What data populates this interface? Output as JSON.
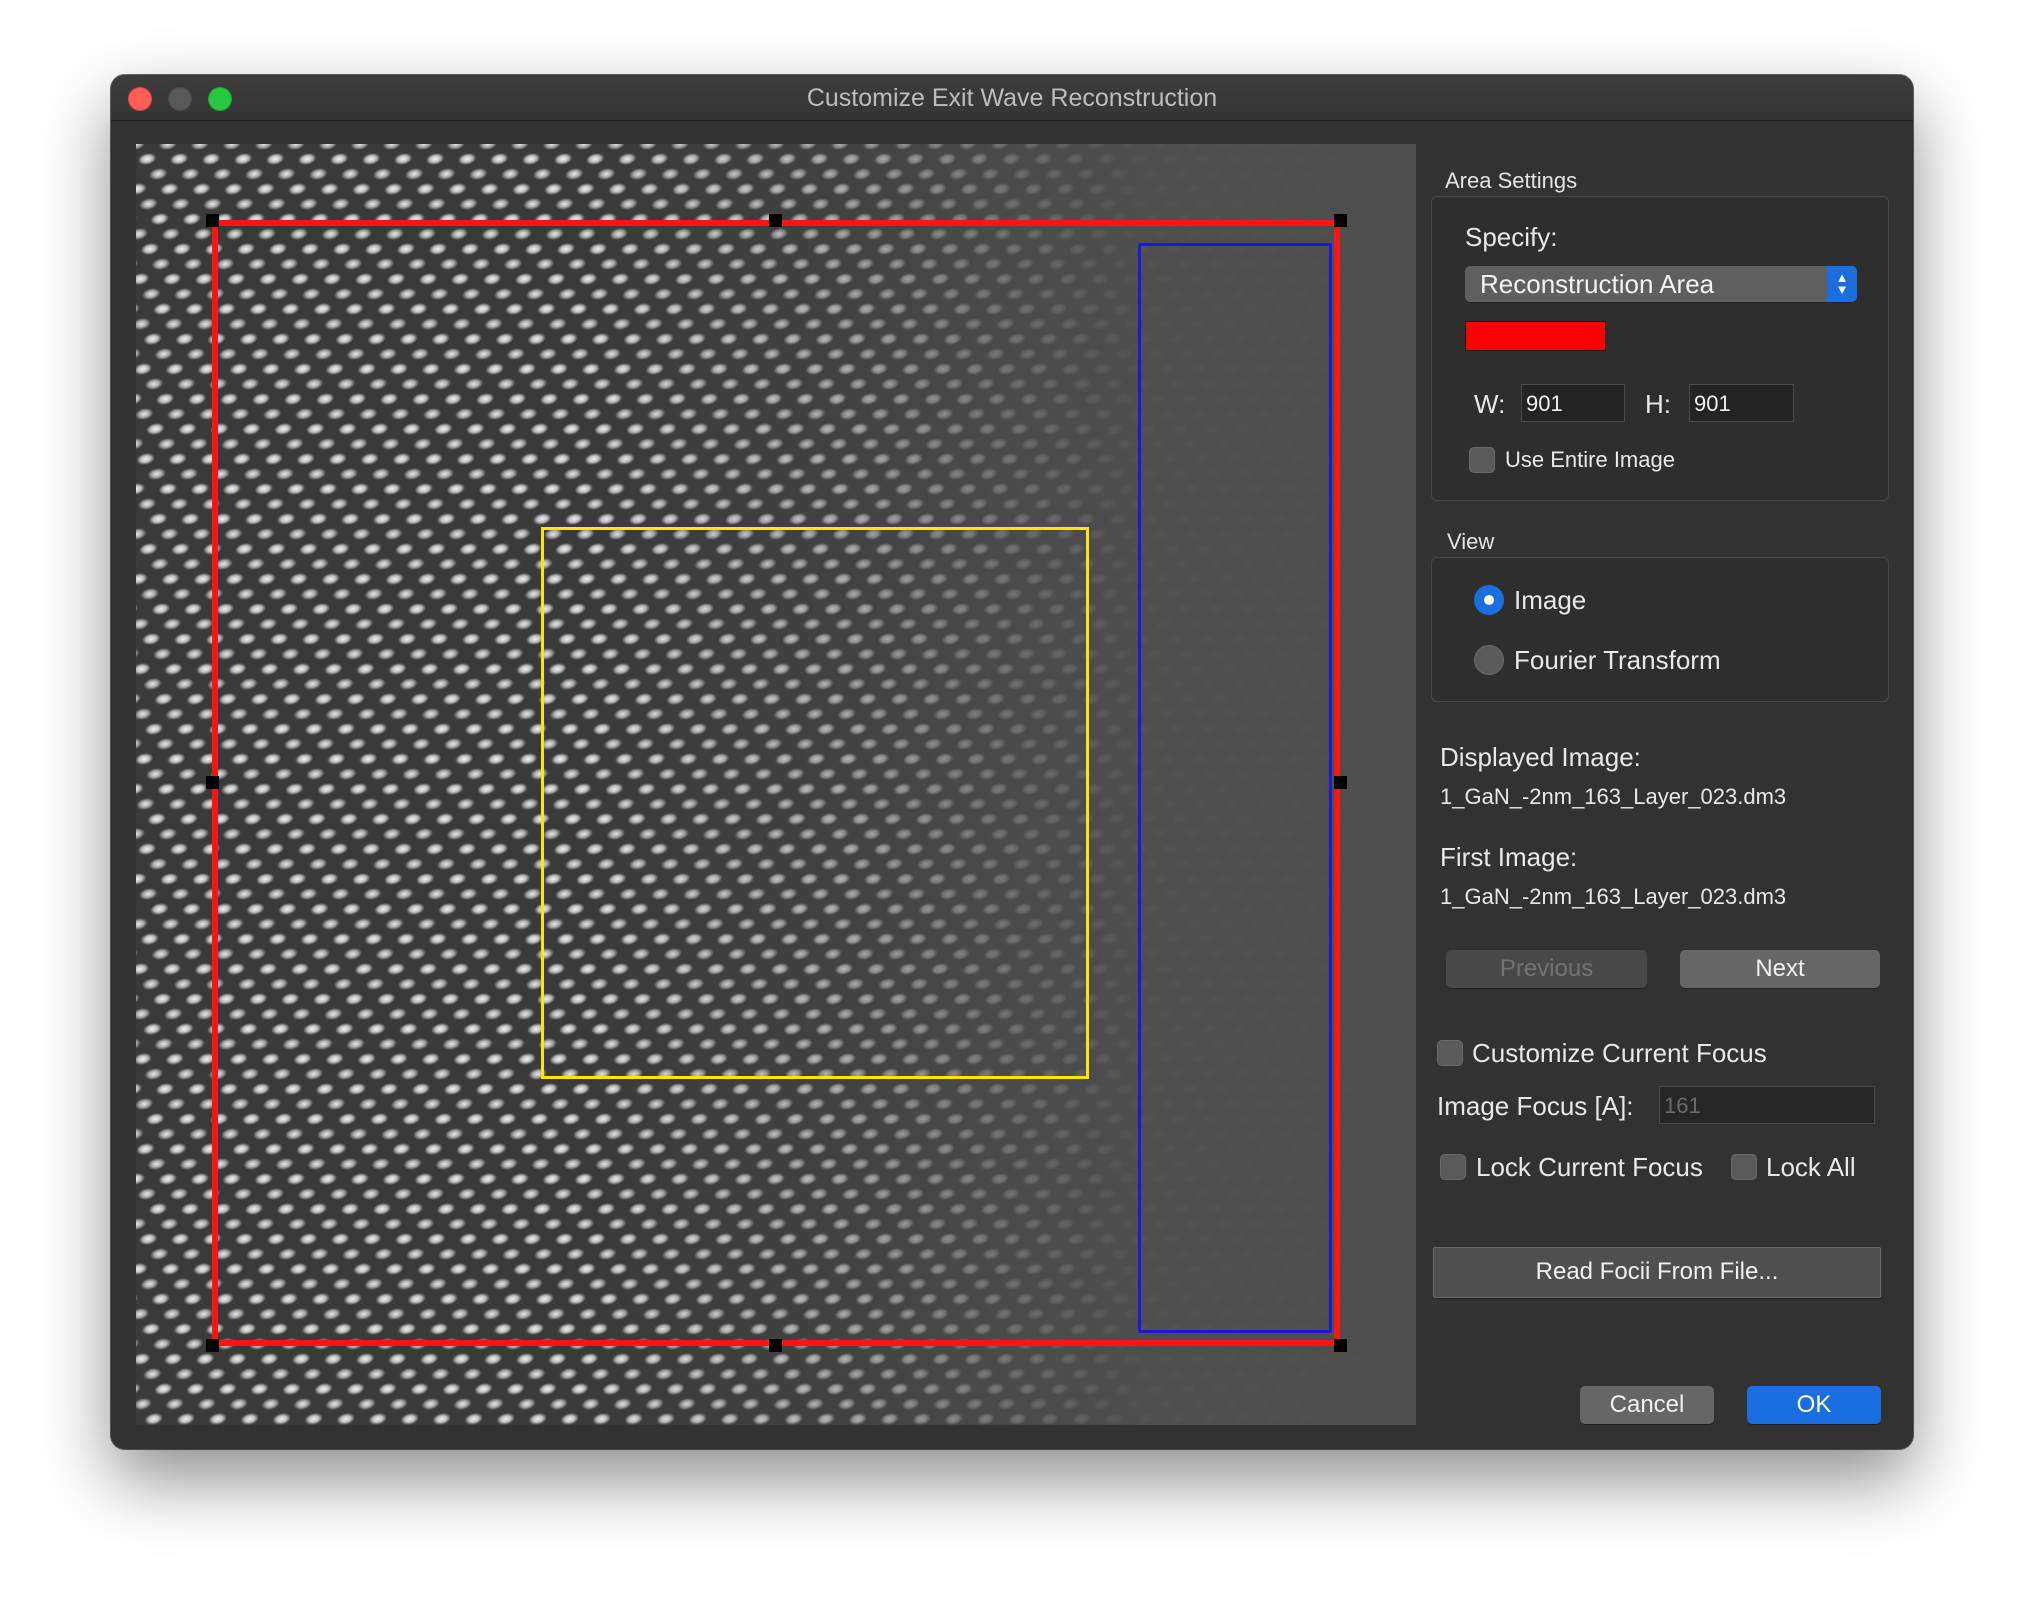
{
  "window": {
    "title": "Customize Exit Wave Reconstruction"
  },
  "image_view": {
    "overlays": [
      {
        "name": "reconstruction-area",
        "color": "#ff1414"
      },
      {
        "name": "background-area",
        "color": "#1a1ad8"
      },
      {
        "name": "focus-area",
        "color": "#ffe600"
      }
    ]
  },
  "area_settings": {
    "group_label": "Area Settings",
    "specify_label": "Specify:",
    "specify_value": "Reconstruction Area",
    "area_color": "#ff0000",
    "width_label": "W:",
    "width_value": "901",
    "height_label": "H:",
    "height_value": "901",
    "use_entire_image_label": "Use Entire Image",
    "use_entire_image_checked": false
  },
  "view": {
    "group_label": "View",
    "options": [
      {
        "label": "Image",
        "selected": true
      },
      {
        "label": "Fourier Transform",
        "selected": false
      }
    ]
  },
  "info": {
    "displayed_image_label": "Displayed Image:",
    "displayed_image_value": "1_GaN_-2nm_163_Layer_023.dm3",
    "first_image_label": "First Image:",
    "first_image_value": "1_GaN_-2nm_163_Layer_023.dm3"
  },
  "navigation": {
    "previous_label": "Previous",
    "next_label": "Next"
  },
  "focus": {
    "customize_label": "Customize Current Focus",
    "customize_checked": false,
    "image_focus_label": "Image Focus [A]:",
    "image_focus_value": "161",
    "lock_current_label": "Lock Current Focus",
    "lock_all_label": "Lock All",
    "read_focii_label": "Read Focii From File..."
  },
  "dialog_buttons": {
    "cancel_label": "Cancel",
    "ok_label": "OK"
  },
  "colors": {
    "accent": "#1a6fe0",
    "window_bg": "#323232"
  }
}
